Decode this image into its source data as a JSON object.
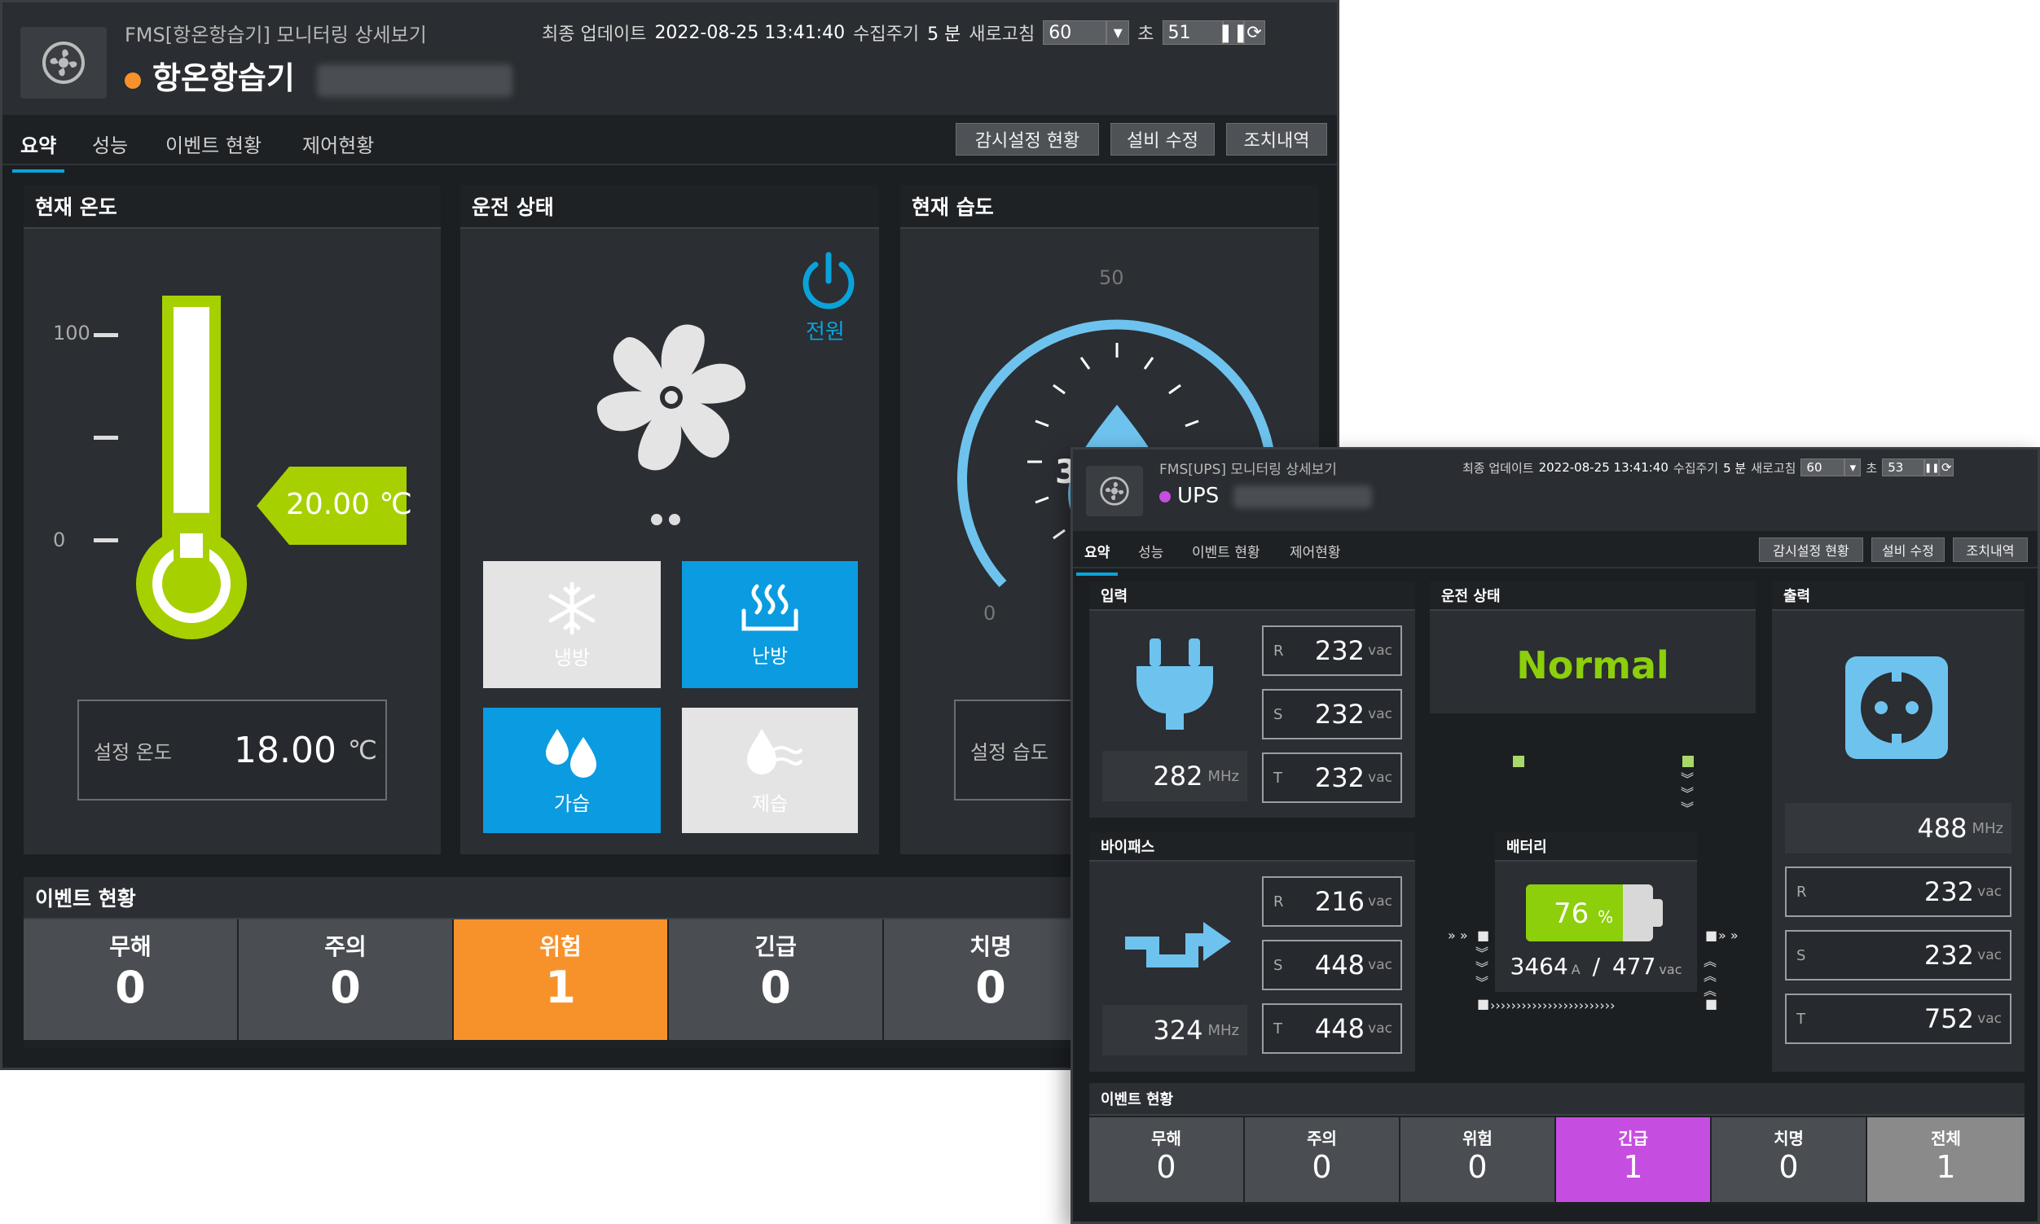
{
  "win1": {
    "subtitle": "FMS[항온항습기] 모니터링 상세보기",
    "title": "항온항습기",
    "status_color": "#f7922b",
    "update_label": "최종 업데이트",
    "update_time": "2022-08-25 13:41:40",
    "period_label": "수집주기",
    "period_value": "5 분",
    "refresh_label": "새로고침",
    "refresh_value": "60",
    "sec_label": "초",
    "sec_value": "51",
    "tabs": [
      "요약",
      "성능",
      "이벤트 현황",
      "제어현황"
    ],
    "buttons": [
      "감시설정 현황",
      "설비 수정",
      "조치내역"
    ],
    "temp": {
      "title": "현재 온도",
      "ticks": [
        "100",
        "",
        "0"
      ],
      "current": "20.00 ℃",
      "fill_pct": 20,
      "set_label": "설정 온도",
      "set_value": "18.00",
      "set_unit": "℃"
    },
    "run": {
      "title": "운전 상태",
      "power_label": "전원",
      "modes": [
        {
          "label": "냉방",
          "active": false,
          "icon": "snowflake-icon"
        },
        {
          "label": "난방",
          "active": true,
          "icon": "heat-icon"
        },
        {
          "label": "가습",
          "active": true,
          "icon": "water-drops-icon"
        },
        {
          "label": "제습",
          "active": false,
          "icon": "dehumidify-icon"
        }
      ]
    },
    "humid": {
      "title": "현재 습도",
      "top_tick": "50",
      "zero_tick": "0",
      "value_partial": "3",
      "set_label": "설정 습도"
    },
    "events": {
      "title": "이벤트 현황",
      "items": [
        {
          "label": "무해",
          "value": "0"
        },
        {
          "label": "주의",
          "value": "0"
        },
        {
          "label": "위험",
          "value": "1",
          "color": "#f7922b"
        },
        {
          "label": "긴급",
          "value": "0"
        },
        {
          "label": "치명",
          "value": "0"
        }
      ]
    }
  },
  "win2": {
    "subtitle": "FMS[UPS] 모니터링 상세보기",
    "title": "UPS",
    "status_color": "#c54ee0",
    "update_label": "최종 업데이트",
    "update_time": "2022-08-25 13:41:40",
    "period_label": "수집주기",
    "period_value": "5 분",
    "refresh_label": "새로고침",
    "refresh_value": "60",
    "sec_label": "초",
    "sec_value": "53",
    "tabs": [
      "요약",
      "성능",
      "이벤트 현황",
      "제어현황"
    ],
    "buttons": [
      "감시설정 현황",
      "설비 수정",
      "조치내역"
    ],
    "input": {
      "title": "입력",
      "freq": "282",
      "freq_unit": "MHz",
      "rst": [
        {
          "k": "R",
          "v": "232",
          "u": "vac"
        },
        {
          "k": "S",
          "v": "232",
          "u": "vac"
        },
        {
          "k": "T",
          "v": "232",
          "u": "vac"
        }
      ]
    },
    "run": {
      "title": "운전 상태",
      "status": "Normal"
    },
    "output": {
      "title": "출력",
      "freq": "488",
      "freq_unit": "MHz",
      "rst": [
        {
          "k": "R",
          "v": "232",
          "u": "vac"
        },
        {
          "k": "S",
          "v": "232",
          "u": "vac"
        },
        {
          "k": "T",
          "v": "752",
          "u": "vac"
        }
      ]
    },
    "bypass": {
      "title": "바이패스",
      "freq": "324",
      "freq_unit": "MHz",
      "rst": [
        {
          "k": "R",
          "v": "216",
          "u": "vac"
        },
        {
          "k": "S",
          "v": "448",
          "u": "vac"
        },
        {
          "k": "T",
          "v": "448",
          "u": "vac"
        }
      ]
    },
    "battery": {
      "title": "배터리",
      "pct": "76",
      "pct_unit": "%",
      "level": 76,
      "amp": "3464",
      "amp_unit": "A",
      "sep": "/",
      "volt": "477",
      "volt_unit": "vac"
    },
    "events": {
      "title": "이벤트 현황",
      "items": [
        {
          "label": "무해",
          "value": "0"
        },
        {
          "label": "주의",
          "value": "0"
        },
        {
          "label": "위험",
          "value": "0"
        },
        {
          "label": "긴급",
          "value": "1",
          "color": "#c54ee0"
        },
        {
          "label": "치명",
          "value": "0"
        },
        {
          "label": "전체",
          "value": "1",
          "color": "#8a8a8a"
        }
      ]
    }
  }
}
